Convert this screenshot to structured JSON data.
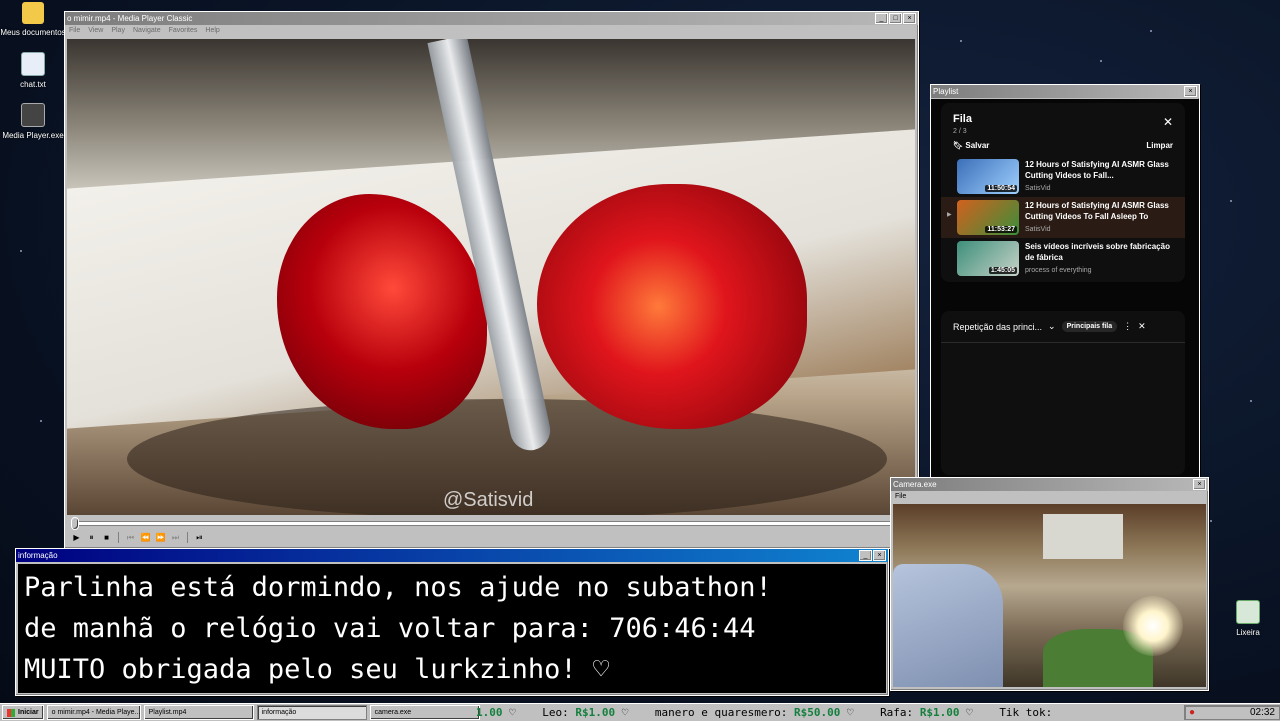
{
  "desktop": {
    "icons": [
      {
        "label": "Meus documentos"
      },
      {
        "label": "chat.txt"
      },
      {
        "label": "Media Player.exe"
      },
      {
        "label": "Lixeira"
      }
    ]
  },
  "media_player": {
    "title": "o mimir.mp4 - Media Player Classic",
    "menu": [
      "File",
      "View",
      "Play",
      "Navigate",
      "Favorites",
      "Help"
    ],
    "watermark": "@Satisvid",
    "controls": {
      "play": "▶",
      "pause": "⏸",
      "stop": "■",
      "prev": "⏮",
      "rew": "⏪",
      "fwd": "⏩",
      "next": "⏭",
      "frame": "⏯",
      "volume": "🔈"
    }
  },
  "playlist": {
    "window_title": "Playlist",
    "queue_title": "Fila",
    "position": "2 / 3",
    "save_label": "Salvar",
    "clear_label": "Limpar",
    "items": [
      {
        "title": "12 Hours of Satisfying AI ASMR Glass Cutting Videos to Fall...",
        "channel": "SatisVid",
        "duration": "11:50:54",
        "thumb_color": "#3b6fb8"
      },
      {
        "title": "12 Hours of Satisfying AI ASMR Glass Cutting Videos To Fall Asleep To",
        "channel": "SatisVid",
        "duration": "11:53:27",
        "thumb_color": "#d2611e"
      },
      {
        "title": "Seis vídeos incríveis sobre fabricação de fábrica",
        "channel": "process of everything",
        "duration": "1:45:05",
        "thumb_color": "#3d8f7a"
      }
    ],
    "secondary": {
      "label": "Repetição das princi...",
      "chip": "Principais fila"
    }
  },
  "info_window": {
    "title": "informação",
    "lines": [
      "Parlinha está dormindo, nos ajude no subathon!",
      "de manhã o relógio vai voltar para:  706:46:44",
      "MUITO obrigada pelo seu lurkzinho! ♡"
    ]
  },
  "camera_window": {
    "title": "Camera.exe",
    "menu": [
      "File"
    ]
  },
  "taskbar": {
    "start": "Iniciar",
    "tasks": [
      {
        "label": "o mimir.mp4 - Media Playe..."
      },
      {
        "label": "Playlist.mp4"
      },
      {
        "label": "informação"
      },
      {
        "label": "camera.exe"
      }
    ],
    "ticker": [
      {
        "name": "",
        "amount": "1.00"
      },
      {
        "name": "Leo:",
        "amount": "R$1.00"
      },
      {
        "name": "manero e quaresmero:",
        "amount": "R$50.00"
      },
      {
        "name": "Rafa:",
        "amount": "R$1.00"
      },
      {
        "name": "Tik tok:",
        "amount": ""
      }
    ],
    "clock": "02:32"
  },
  "colors": {
    "title_active": "#000080",
    "title_inactive": "#7d7d7d",
    "ticker_amount": "#15803d",
    "yt_bg": "#0f0f0f"
  }
}
